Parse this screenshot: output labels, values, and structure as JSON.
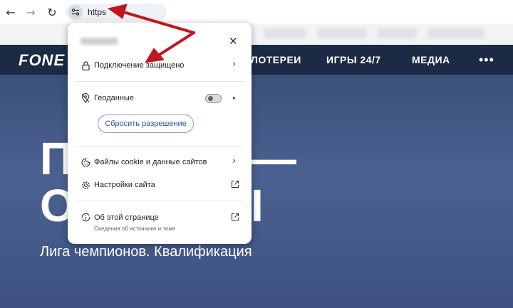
{
  "browser": {
    "back_icon": "←",
    "forward_icon": "→",
    "reload_icon": "↻",
    "url": "https"
  },
  "site": {
    "logo": "FONE",
    "nav": [
      "ЛОТЕРЕИ",
      "ИГРЫ 24/7",
      "МЕДИА"
    ],
    "more": "•••",
    "hero_line1_left": "П",
    "hero_line1_right": "—",
    "hero_line2_left": "О",
    "hero_line2_right": "I",
    "hero_subtitle": "Лига чемпионов. Квалификация"
  },
  "popup": {
    "close": "✕",
    "connection_label": "Подключение защищено",
    "geo_label": "Геоданные",
    "geo_enabled": false,
    "reset_label": "Сбросить разрешение",
    "cookies_label": "Файлы cookie и данные сайтов",
    "settings_label": "Настройки сайта",
    "about_label": "Об этой странице",
    "about_sub": "Сведения об источнике и теме",
    "chevron": "›",
    "triangle": "▸"
  },
  "annotation_color": "#c0161c"
}
